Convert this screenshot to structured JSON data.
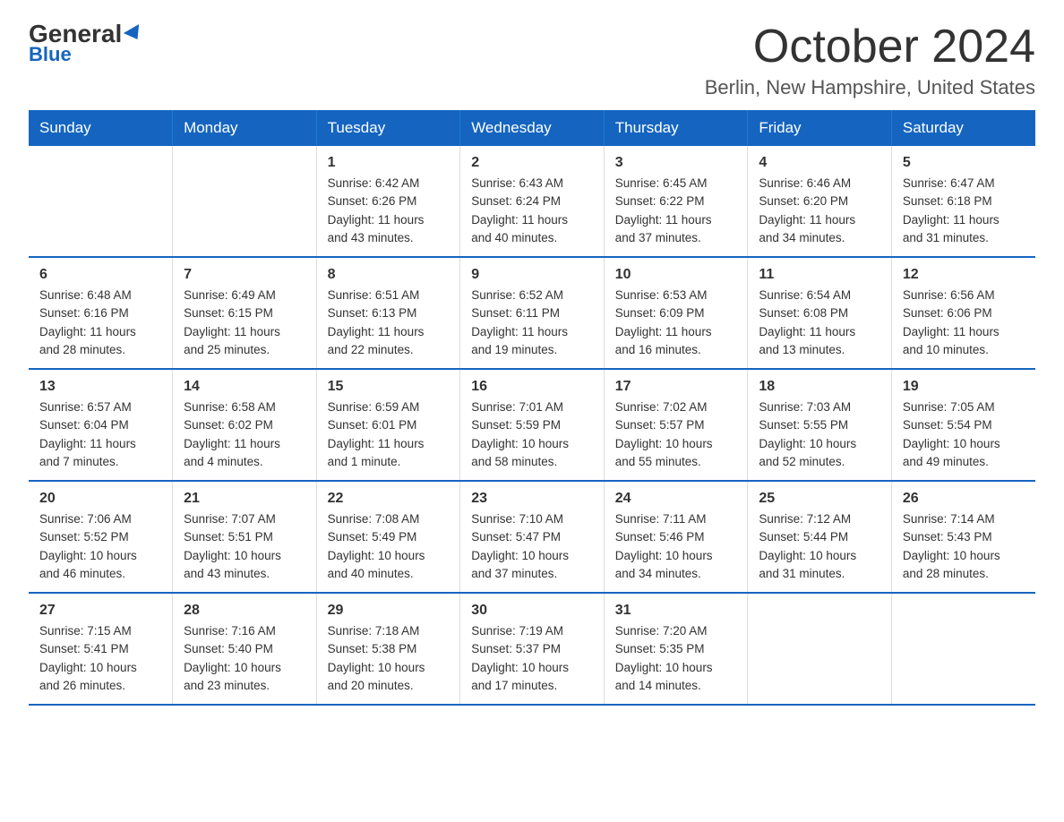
{
  "logo": {
    "general": "General",
    "blue": "Blue"
  },
  "title": "October 2024",
  "location": "Berlin, New Hampshire, United States",
  "weekdays": [
    "Sunday",
    "Monday",
    "Tuesday",
    "Wednesday",
    "Thursday",
    "Friday",
    "Saturday"
  ],
  "weeks": [
    [
      {
        "day": "",
        "info": ""
      },
      {
        "day": "",
        "info": ""
      },
      {
        "day": "1",
        "info": "Sunrise: 6:42 AM\nSunset: 6:26 PM\nDaylight: 11 hours\nand 43 minutes."
      },
      {
        "day": "2",
        "info": "Sunrise: 6:43 AM\nSunset: 6:24 PM\nDaylight: 11 hours\nand 40 minutes."
      },
      {
        "day": "3",
        "info": "Sunrise: 6:45 AM\nSunset: 6:22 PM\nDaylight: 11 hours\nand 37 minutes."
      },
      {
        "day": "4",
        "info": "Sunrise: 6:46 AM\nSunset: 6:20 PM\nDaylight: 11 hours\nand 34 minutes."
      },
      {
        "day": "5",
        "info": "Sunrise: 6:47 AM\nSunset: 6:18 PM\nDaylight: 11 hours\nand 31 minutes."
      }
    ],
    [
      {
        "day": "6",
        "info": "Sunrise: 6:48 AM\nSunset: 6:16 PM\nDaylight: 11 hours\nand 28 minutes."
      },
      {
        "day": "7",
        "info": "Sunrise: 6:49 AM\nSunset: 6:15 PM\nDaylight: 11 hours\nand 25 minutes."
      },
      {
        "day": "8",
        "info": "Sunrise: 6:51 AM\nSunset: 6:13 PM\nDaylight: 11 hours\nand 22 minutes."
      },
      {
        "day": "9",
        "info": "Sunrise: 6:52 AM\nSunset: 6:11 PM\nDaylight: 11 hours\nand 19 minutes."
      },
      {
        "day": "10",
        "info": "Sunrise: 6:53 AM\nSunset: 6:09 PM\nDaylight: 11 hours\nand 16 minutes."
      },
      {
        "day": "11",
        "info": "Sunrise: 6:54 AM\nSunset: 6:08 PM\nDaylight: 11 hours\nand 13 minutes."
      },
      {
        "day": "12",
        "info": "Sunrise: 6:56 AM\nSunset: 6:06 PM\nDaylight: 11 hours\nand 10 minutes."
      }
    ],
    [
      {
        "day": "13",
        "info": "Sunrise: 6:57 AM\nSunset: 6:04 PM\nDaylight: 11 hours\nand 7 minutes."
      },
      {
        "day": "14",
        "info": "Sunrise: 6:58 AM\nSunset: 6:02 PM\nDaylight: 11 hours\nand 4 minutes."
      },
      {
        "day": "15",
        "info": "Sunrise: 6:59 AM\nSunset: 6:01 PM\nDaylight: 11 hours\nand 1 minute."
      },
      {
        "day": "16",
        "info": "Sunrise: 7:01 AM\nSunset: 5:59 PM\nDaylight: 10 hours\nand 58 minutes."
      },
      {
        "day": "17",
        "info": "Sunrise: 7:02 AM\nSunset: 5:57 PM\nDaylight: 10 hours\nand 55 minutes."
      },
      {
        "day": "18",
        "info": "Sunrise: 7:03 AM\nSunset: 5:55 PM\nDaylight: 10 hours\nand 52 minutes."
      },
      {
        "day": "19",
        "info": "Sunrise: 7:05 AM\nSunset: 5:54 PM\nDaylight: 10 hours\nand 49 minutes."
      }
    ],
    [
      {
        "day": "20",
        "info": "Sunrise: 7:06 AM\nSunset: 5:52 PM\nDaylight: 10 hours\nand 46 minutes."
      },
      {
        "day": "21",
        "info": "Sunrise: 7:07 AM\nSunset: 5:51 PM\nDaylight: 10 hours\nand 43 minutes."
      },
      {
        "day": "22",
        "info": "Sunrise: 7:08 AM\nSunset: 5:49 PM\nDaylight: 10 hours\nand 40 minutes."
      },
      {
        "day": "23",
        "info": "Sunrise: 7:10 AM\nSunset: 5:47 PM\nDaylight: 10 hours\nand 37 minutes."
      },
      {
        "day": "24",
        "info": "Sunrise: 7:11 AM\nSunset: 5:46 PM\nDaylight: 10 hours\nand 34 minutes."
      },
      {
        "day": "25",
        "info": "Sunrise: 7:12 AM\nSunset: 5:44 PM\nDaylight: 10 hours\nand 31 minutes."
      },
      {
        "day": "26",
        "info": "Sunrise: 7:14 AM\nSunset: 5:43 PM\nDaylight: 10 hours\nand 28 minutes."
      }
    ],
    [
      {
        "day": "27",
        "info": "Sunrise: 7:15 AM\nSunset: 5:41 PM\nDaylight: 10 hours\nand 26 minutes."
      },
      {
        "day": "28",
        "info": "Sunrise: 7:16 AM\nSunset: 5:40 PM\nDaylight: 10 hours\nand 23 minutes."
      },
      {
        "day": "29",
        "info": "Sunrise: 7:18 AM\nSunset: 5:38 PM\nDaylight: 10 hours\nand 20 minutes."
      },
      {
        "day": "30",
        "info": "Sunrise: 7:19 AM\nSunset: 5:37 PM\nDaylight: 10 hours\nand 17 minutes."
      },
      {
        "day": "31",
        "info": "Sunrise: 7:20 AM\nSunset: 5:35 PM\nDaylight: 10 hours\nand 14 minutes."
      },
      {
        "day": "",
        "info": ""
      },
      {
        "day": "",
        "info": ""
      }
    ]
  ]
}
